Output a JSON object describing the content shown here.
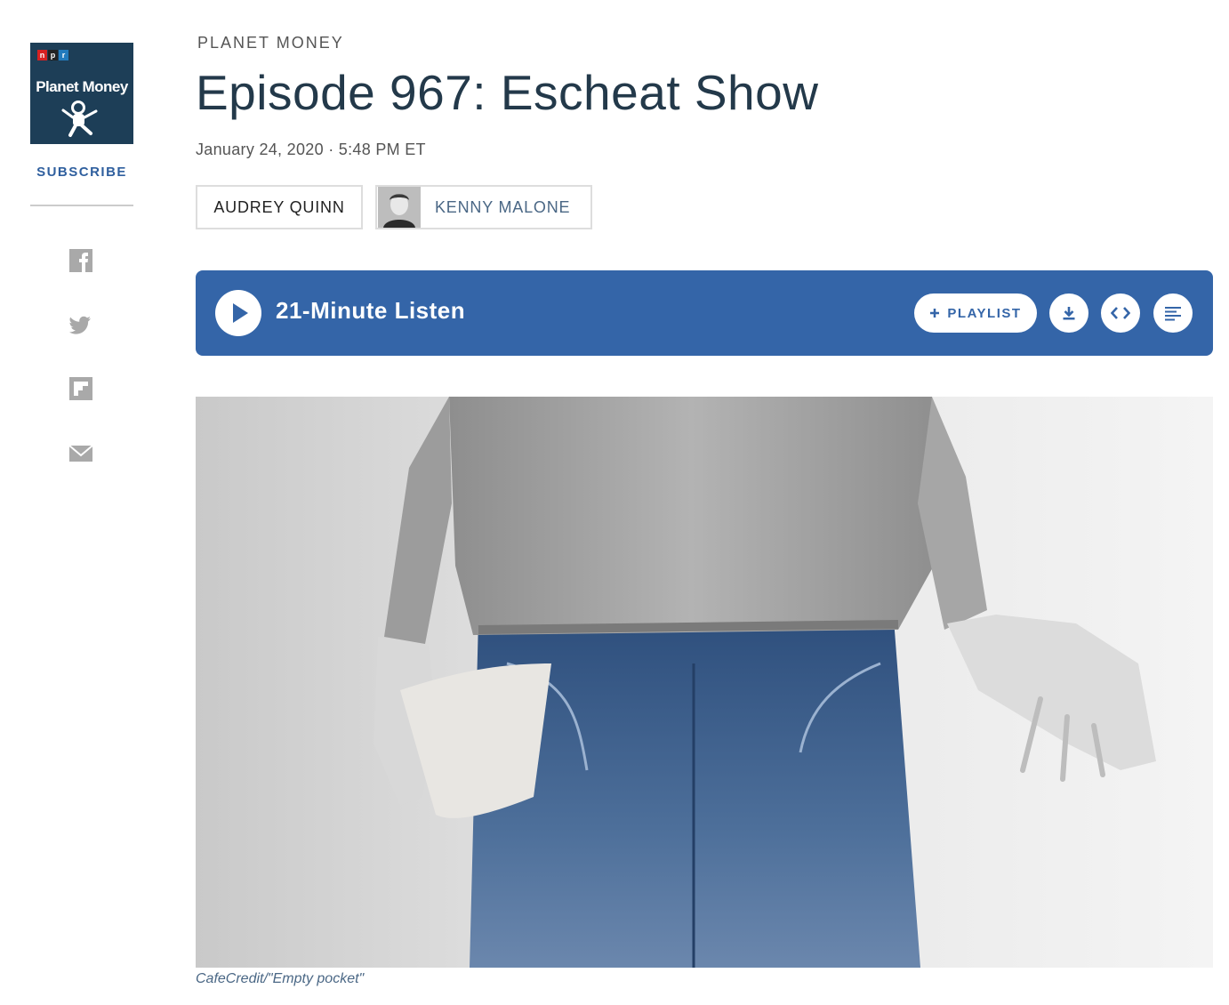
{
  "sidebar": {
    "logo": {
      "npr_letters": [
        "n",
        "p",
        "r"
      ],
      "title": "Planet Money"
    },
    "subscribe_label": "SUBSCRIBE",
    "share_icons": [
      "facebook-icon",
      "twitter-icon",
      "flipboard-icon",
      "email-icon"
    ]
  },
  "story": {
    "slug": "PLANET MONEY",
    "title": "Episode 967: Escheat Show",
    "dateline": "January 24, 2020 · 5:48 PM ET",
    "bylines": [
      "AUDREY QUINN",
      "KENNY MALONE"
    ]
  },
  "player": {
    "listen_label": "21-Minute Listen",
    "playlist_label": "PLAYLIST",
    "icons": [
      "play-icon",
      "plus-icon",
      "download-icon",
      "embed-icon",
      "transcript-icon"
    ]
  },
  "image": {
    "caption": "CafeCredit/\"Empty pocket\""
  },
  "colors": {
    "accent": "#3465a8",
    "title": "#23394a",
    "link": "#2f5f9e",
    "logo_bg": "#1d3e57"
  }
}
